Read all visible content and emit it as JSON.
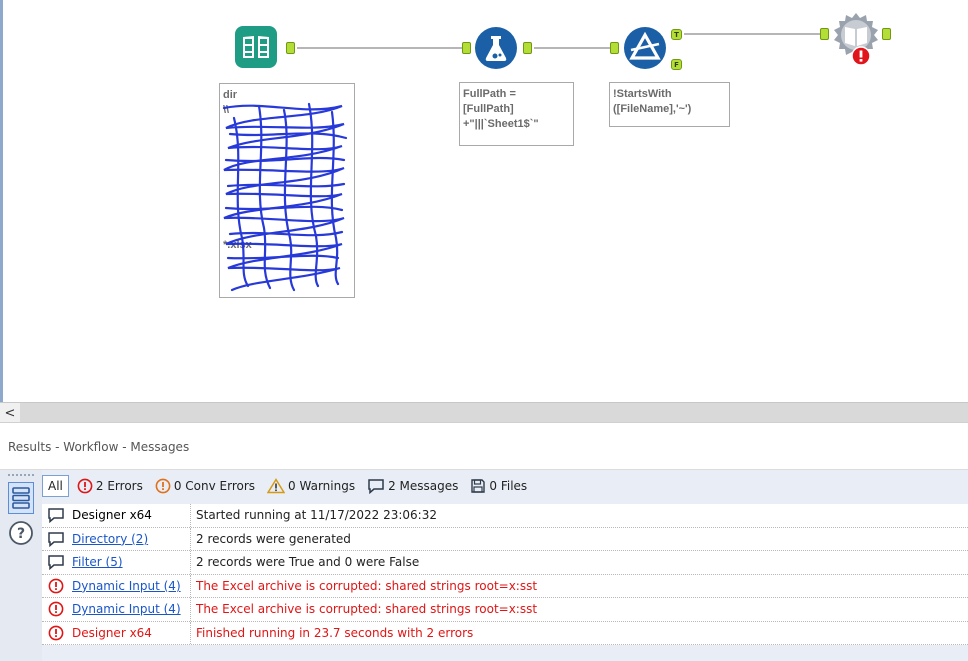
{
  "canvas": {
    "tools": [
      {
        "name": "Directory",
        "annotation": "dir\n\\\\\n\n\n\n\n\n\n\n\n*.xlsx"
      },
      {
        "name": "Formula",
        "annotation": "FullPath =\n[FullPath]\n+\"|||`Sheet1$`\""
      },
      {
        "name": "Filter",
        "annotation": "!StartsWith\n([FileName],'~')",
        "true_anchor": "T",
        "false_anchor": "F"
      },
      {
        "name": "Dynamic Input"
      }
    ]
  },
  "scrollbar": {
    "left_arrow": "<"
  },
  "panel": {
    "title": "Results - Workflow - Messages"
  },
  "filters": {
    "all": "All",
    "errors": "2 Errors",
    "conv_errors": "0 Conv Errors",
    "warnings": "0 Warnings",
    "messages": "2 Messages",
    "files": "0 Files"
  },
  "messages": [
    {
      "type": "message",
      "source": "Designer x64",
      "text": "Started running at 11/17/2022 23:06:32"
    },
    {
      "type": "message",
      "source": "Directory (2)",
      "text": "2 records were generated"
    },
    {
      "type": "message",
      "source": "Filter (5)",
      "text": "2 records were True and 0 were False"
    },
    {
      "type": "error",
      "source": "Dynamic Input (4)",
      "text": "The Excel archive is corrupted: shared strings root=x:sst"
    },
    {
      "type": "error",
      "source": "Dynamic Input (4)",
      "text": "The Excel archive is corrupted: shared strings root=x:sst"
    },
    {
      "type": "error",
      "source": "Designer x64",
      "text": "Finished running in 23.7 seconds with 2 errors"
    }
  ],
  "colors": {
    "error": "#e01515",
    "link": "#1a56c9",
    "anchor": "#b4dd38"
  }
}
